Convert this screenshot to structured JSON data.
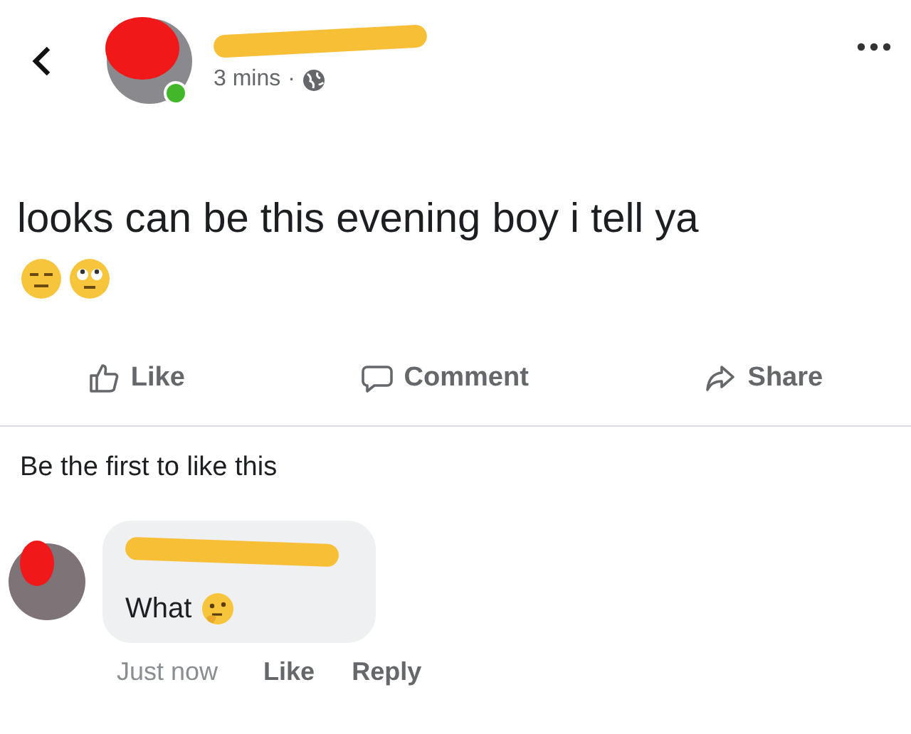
{
  "post": {
    "time": "3 mins",
    "separator": "·",
    "text": "looks can be this evening boy i tell ya",
    "online": true
  },
  "actions": [
    {
      "kind": "like",
      "label": "Like"
    },
    {
      "kind": "comment",
      "label": "Comment"
    },
    {
      "kind": "share",
      "label": "Share"
    }
  ],
  "likes_summary": "Be the first to like this",
  "comment": {
    "text": "What",
    "time": "Just now",
    "actions": [
      "Like",
      "Reply"
    ]
  }
}
